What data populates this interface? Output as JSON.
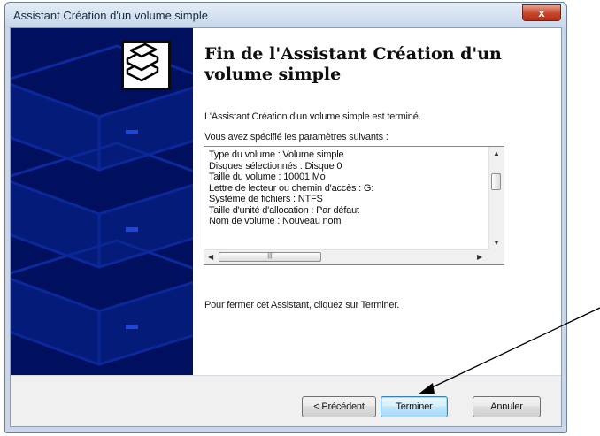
{
  "window": {
    "title": "Assistant Création d'un volume simple",
    "close_label": "x"
  },
  "main": {
    "heading": "Fin de l'Assistant Création d'un volume simple",
    "completed_text": "L'Assistant Création d'un volume simple est terminé.",
    "params_label": "Vous avez spécifié les paramètres suivants :",
    "params": [
      "Type du volume : Volume simple",
      "Disques sélectionnés : Disque 0",
      "Taille du volume : 10001 Mo",
      "Lettre de lecteur ou chemin d'accès : G:",
      "Système de fichiers : NTFS",
      "Taille d'unité d'allocation : Par défaut",
      "Nom de volume : Nouveau nom"
    ],
    "close_instruction": "Pour fermer cet Assistant, cliquez sur Terminer."
  },
  "buttons": {
    "previous": "< Précédent",
    "finish": "Terminer",
    "cancel": "Annuler"
  },
  "colors": {
    "banner": "#01105e",
    "close_button": "#c8452a"
  }
}
